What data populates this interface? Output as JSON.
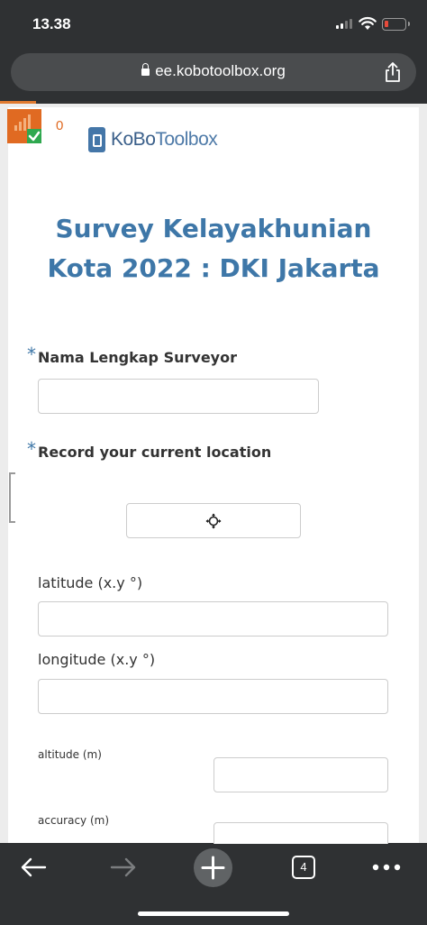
{
  "status_bar": {
    "time": "13.38"
  },
  "browser": {
    "url": "ee.kobotoolbox.org",
    "tab_count": "4"
  },
  "offline": {
    "queue_count": "0"
  },
  "logo": {
    "bold": "KoBo",
    "light": "Toolbox"
  },
  "form": {
    "title": "Survey Kelayakhunian Kota 2022 : DKI Jakarta",
    "required_mark": "*",
    "q_name": "Nama Lengkap Surveyor",
    "q_location": "Record your current location",
    "latitude_label": "latitude (x.y °)",
    "longitude_label": "longitude (x.y °)",
    "altitude_label": "altitude (m)",
    "accuracy_label": "accuracy (m)"
  },
  "colors": {
    "accent": "#3e77a8",
    "offline_orange": "#e06a22",
    "chrome_dark": "#2f3133"
  }
}
